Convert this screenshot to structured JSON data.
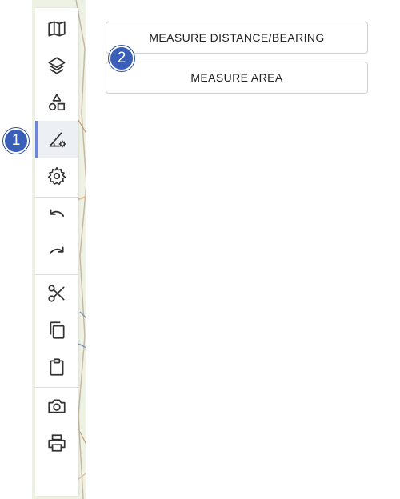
{
  "toolbar": {
    "items": [
      {
        "icon": "map-icon"
      },
      {
        "icon": "layers-icon"
      },
      {
        "icon": "shapes-icon"
      },
      {
        "icon": "measure-tool-icon",
        "active": true
      },
      {
        "icon": "settings-icon"
      },
      {
        "icon": "undo-icon"
      },
      {
        "icon": "redo-icon"
      },
      {
        "icon": "scissors-icon"
      },
      {
        "icon": "copy-icon"
      },
      {
        "icon": "clipboard-icon"
      },
      {
        "icon": "camera-icon"
      },
      {
        "icon": "print-icon"
      }
    ]
  },
  "annotations": {
    "marker_1": "1",
    "marker_2": "2"
  },
  "measure_panel": {
    "distance_label": "MEASURE DISTANCE/BEARING",
    "area_label": "MEASURE AREA"
  },
  "colors": {
    "active_indicator": "#6f86d6",
    "marker_fill": "#3a5fb8",
    "icon": "#333333"
  }
}
